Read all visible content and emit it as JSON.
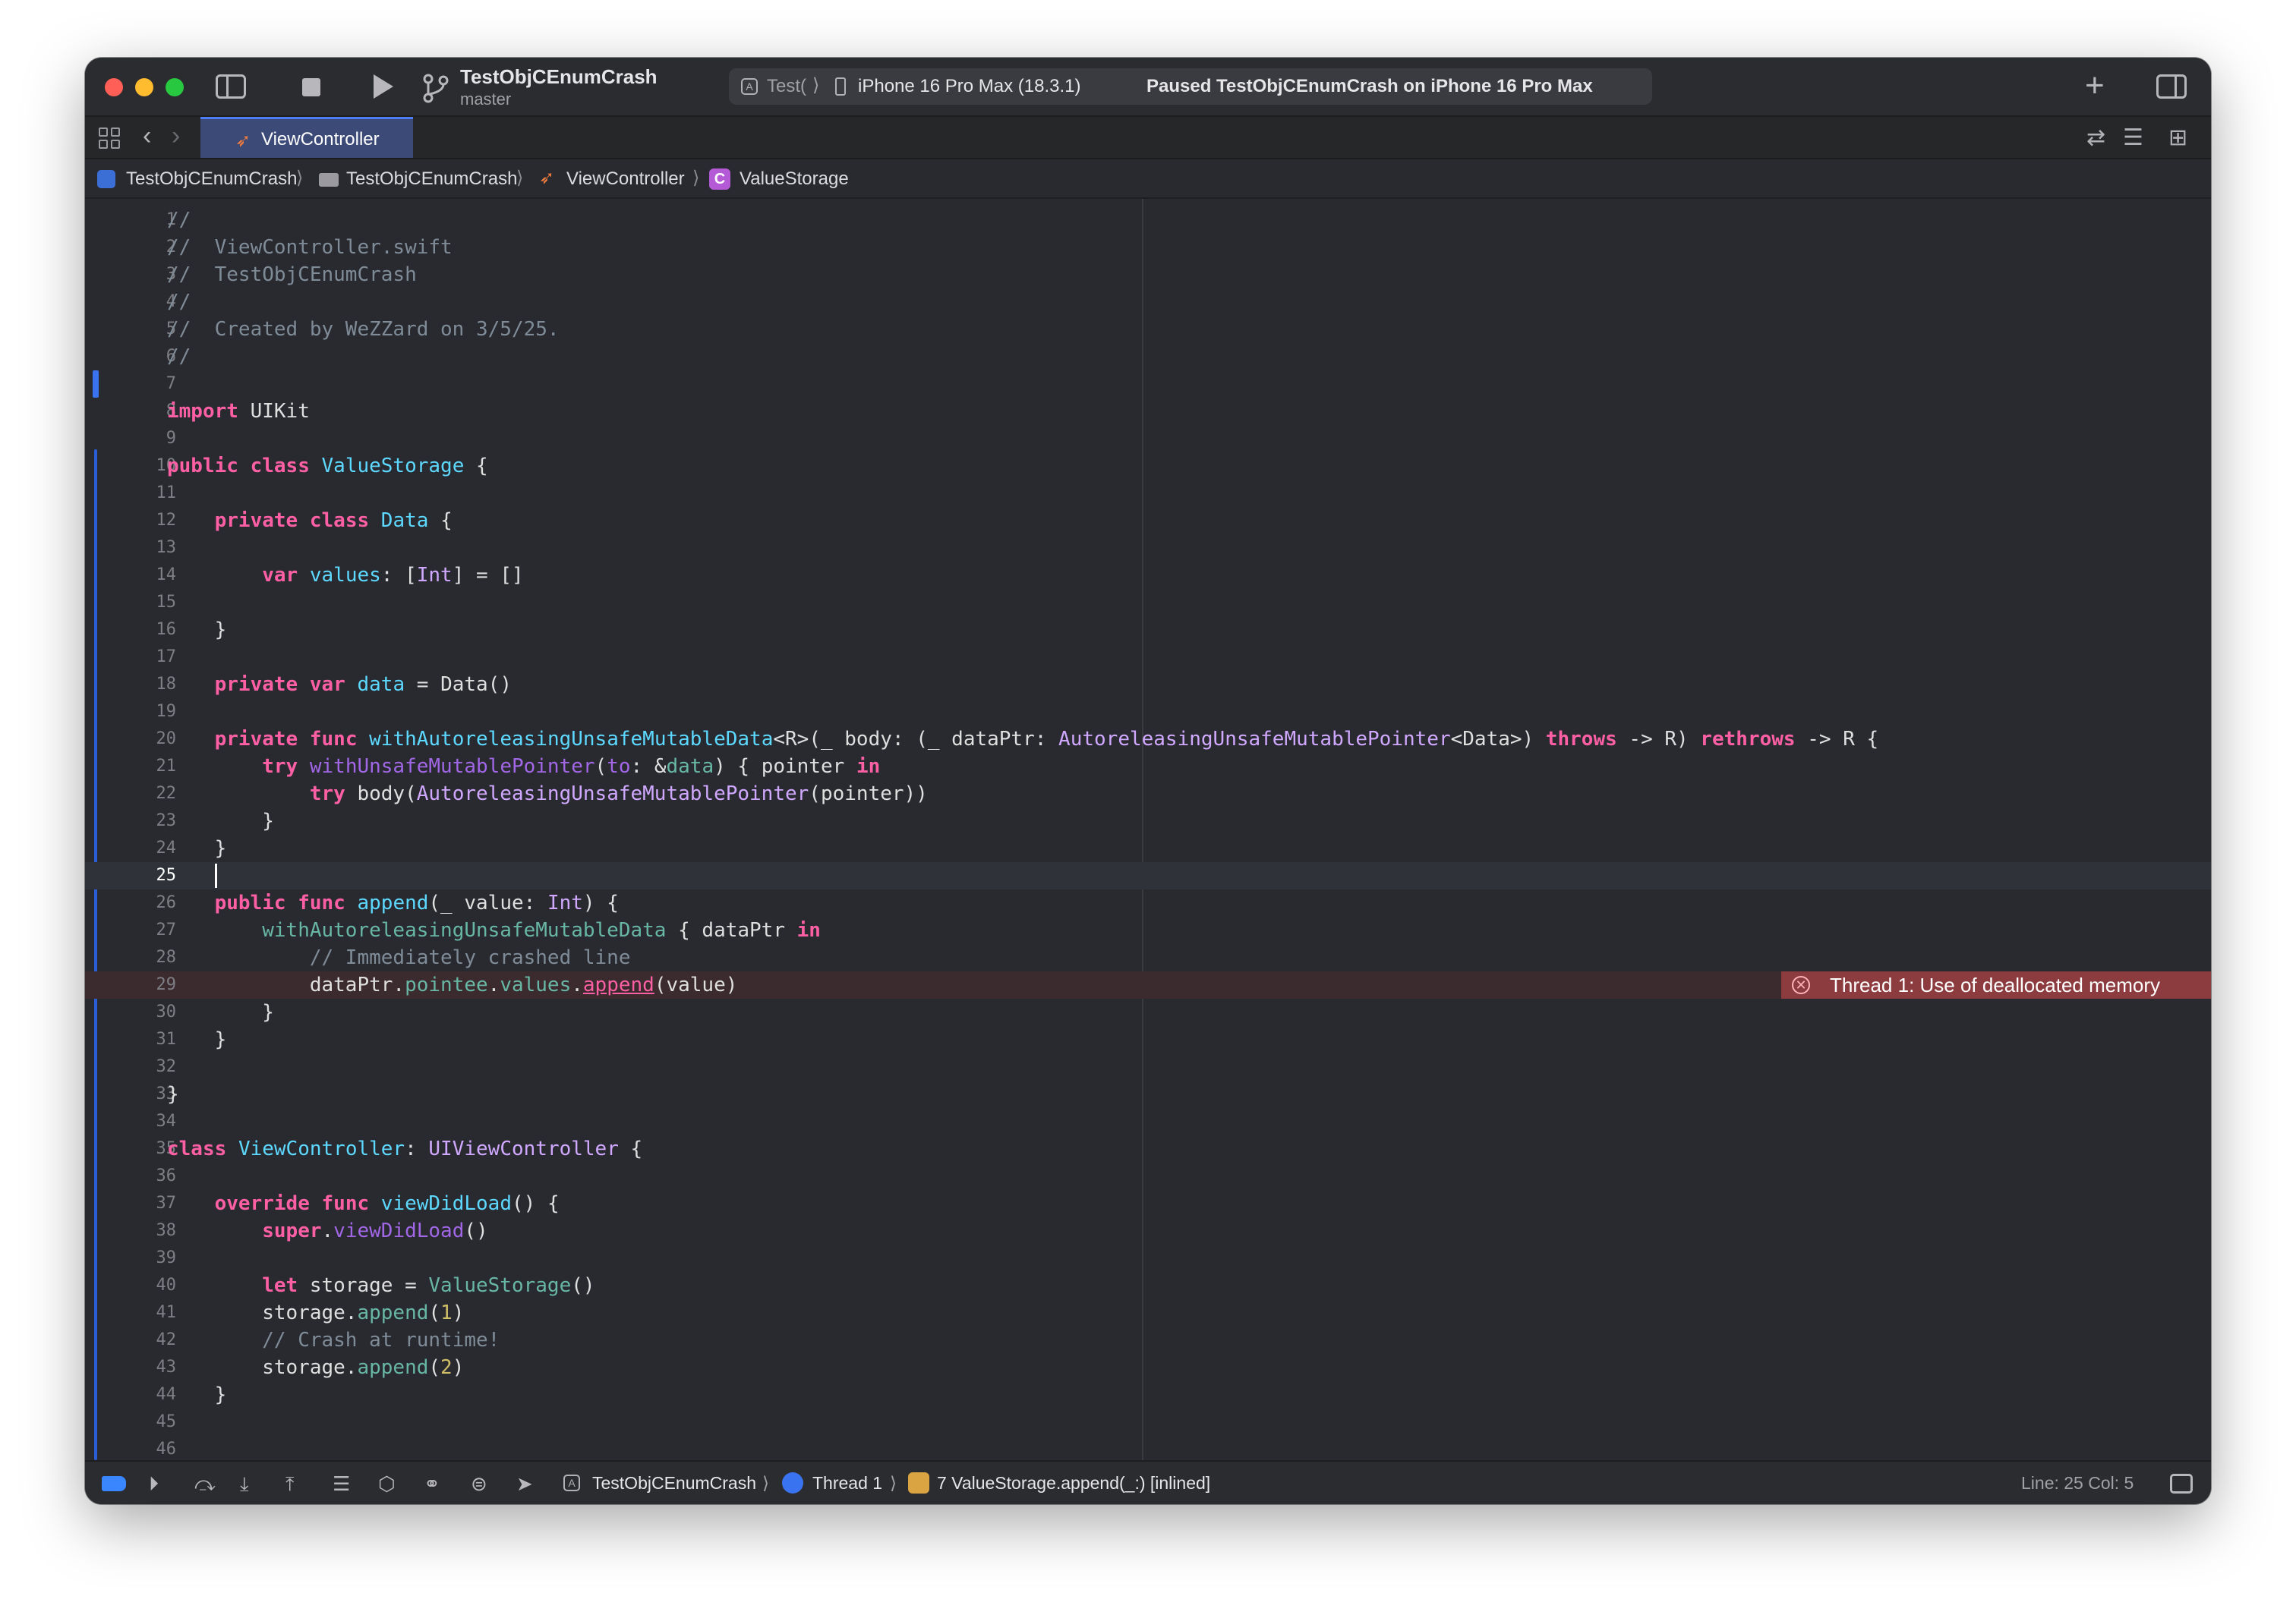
{
  "window": {
    "scheme_name": "TestObjCEnumCrash",
    "branch": "master",
    "destination_scheme": "Test(",
    "destination_device": "iPhone 16 Pro Max (18.3.1)",
    "status": "Paused TestObjCEnumCrash on iPhone 16 Pro Max"
  },
  "tabs": [
    {
      "label": "ViewController",
      "active": true
    }
  ],
  "breadcrumb": {
    "project": "TestObjCEnumCrash",
    "folder": "TestObjCEnumCrash",
    "file": "ViewController",
    "symbol": "ValueStorage",
    "symbol_kind": "C"
  },
  "editor": {
    "current_line": 25,
    "error_line": 29,
    "error_message": "Thread 1: Use of deallocated memory",
    "lines": [
      [
        [
          "cm",
          "//"
        ]
      ],
      [
        [
          "cm",
          "//  ViewController.swift"
        ]
      ],
      [
        [
          "cm",
          "//  TestObjCEnumCrash"
        ]
      ],
      [
        [
          "cm",
          "//"
        ]
      ],
      [
        [
          "cm",
          "//  Created by WeZZard on 3/5/25."
        ]
      ],
      [
        [
          "cm",
          "//"
        ]
      ],
      [],
      [
        [
          "k",
          "import"
        ],
        [
          "pl",
          " UIKit"
        ]
      ],
      [],
      [
        [
          "k",
          "public"
        ],
        [
          "pl",
          " "
        ],
        [
          "k",
          "class"
        ],
        [
          "pl",
          " "
        ],
        [
          "t",
          "ValueStorage"
        ],
        [
          "pl",
          " {"
        ]
      ],
      [],
      [
        [
          "pl",
          "    "
        ],
        [
          "k",
          "private"
        ],
        [
          "pl",
          " "
        ],
        [
          "k",
          "class"
        ],
        [
          "pl",
          " "
        ],
        [
          "t",
          "Data"
        ],
        [
          "pl",
          " {"
        ]
      ],
      [],
      [
        [
          "pl",
          "        "
        ],
        [
          "k",
          "var"
        ],
        [
          "pl",
          " "
        ],
        [
          "t",
          "values"
        ],
        [
          "pl",
          ": ["
        ],
        [
          "tp",
          "Int"
        ],
        [
          "pl",
          "] = []"
        ]
      ],
      [],
      [
        [
          "pl",
          "    }"
        ]
      ],
      [],
      [
        [
          "pl",
          "    "
        ],
        [
          "k",
          "private"
        ],
        [
          "pl",
          " "
        ],
        [
          "k",
          "var"
        ],
        [
          "pl",
          " "
        ],
        [
          "t",
          "data"
        ],
        [
          "pl",
          " = Data()"
        ]
      ],
      [],
      [
        [
          "pl",
          "    "
        ],
        [
          "k",
          "private"
        ],
        [
          "pl",
          " "
        ],
        [
          "k",
          "func"
        ],
        [
          "pl",
          " "
        ],
        [
          "t",
          "withAutoreleasingUnsafeMutableData"
        ],
        [
          "pl",
          "<R>(_ body: (_ dataPtr: "
        ],
        [
          "tp",
          "AutoreleasingUnsafeMutablePointer"
        ],
        [
          "pl",
          "<Data>) "
        ],
        [
          "k",
          "throws"
        ],
        [
          "pl",
          " -> R) "
        ],
        [
          "k",
          "rethrows"
        ],
        [
          "pl",
          " -> R {"
        ]
      ],
      [
        [
          "pl",
          "        "
        ],
        [
          "k",
          "try"
        ],
        [
          "pl",
          " "
        ],
        [
          "mu",
          "withUnsafeMutablePointer"
        ],
        [
          "pl",
          "("
        ],
        [
          "mu",
          "to"
        ],
        [
          "pl",
          ": &"
        ],
        [
          "fn",
          "data"
        ],
        [
          "pl",
          ") { pointer "
        ],
        [
          "k",
          "in"
        ]
      ],
      [
        [
          "pl",
          "            "
        ],
        [
          "k",
          "try"
        ],
        [
          "pl",
          " body("
        ],
        [
          "tp",
          "AutoreleasingUnsafeMutablePointer"
        ],
        [
          "pl",
          "(pointer))"
        ]
      ],
      [
        [
          "pl",
          "        }"
        ]
      ],
      [
        [
          "pl",
          "    }"
        ]
      ],
      [
        [
          "pl",
          "    "
        ]
      ],
      [
        [
          "pl",
          "    "
        ],
        [
          "k",
          "public"
        ],
        [
          "pl",
          " "
        ],
        [
          "k",
          "func"
        ],
        [
          "pl",
          " "
        ],
        [
          "t",
          "append"
        ],
        [
          "pl",
          "(_ value: "
        ],
        [
          "tp",
          "Int"
        ],
        [
          "pl",
          ") {"
        ]
      ],
      [
        [
          "pl",
          "        "
        ],
        [
          "fn",
          "withAutoreleasingUnsafeMutableData"
        ],
        [
          "pl",
          " { dataPtr "
        ],
        [
          "k",
          "in"
        ]
      ],
      [
        [
          "pl",
          "            "
        ],
        [
          "cm",
          "// Immediately crashed line"
        ]
      ],
      [
        [
          "pl",
          "            dataPtr."
        ],
        [
          "fn",
          "pointee"
        ],
        [
          "pl",
          "."
        ],
        [
          "fn",
          "values"
        ],
        [
          "pl",
          "."
        ],
        [
          "err",
          "append"
        ],
        [
          "pl",
          "(value)"
        ]
      ],
      [
        [
          "pl",
          "        }"
        ]
      ],
      [
        [
          "pl",
          "    }"
        ]
      ],
      [],
      [
        [
          "pl",
          "}"
        ]
      ],
      [],
      [
        [
          "k",
          "class"
        ],
        [
          "pl",
          " "
        ],
        [
          "t",
          "ViewController"
        ],
        [
          "pl",
          ": "
        ],
        [
          "tp",
          "UIViewController"
        ],
        [
          "pl",
          " {"
        ]
      ],
      [],
      [
        [
          "pl",
          "    "
        ],
        [
          "k",
          "override"
        ],
        [
          "pl",
          " "
        ],
        [
          "k",
          "func"
        ],
        [
          "pl",
          " "
        ],
        [
          "t",
          "viewDidLoad"
        ],
        [
          "pl",
          "() {"
        ]
      ],
      [
        [
          "pl",
          "        "
        ],
        [
          "k",
          "super"
        ],
        [
          "pl",
          "."
        ],
        [
          "mu",
          "viewDidLoad"
        ],
        [
          "pl",
          "()"
        ]
      ],
      [],
      [
        [
          "pl",
          "        "
        ],
        [
          "k",
          "let"
        ],
        [
          "pl",
          " storage = "
        ],
        [
          "fn",
          "ValueStorage"
        ],
        [
          "pl",
          "()"
        ]
      ],
      [
        [
          "pl",
          "        storage."
        ],
        [
          "fn",
          "append"
        ],
        [
          "pl",
          "("
        ],
        [
          "nm",
          "1"
        ],
        [
          "pl",
          ")"
        ]
      ],
      [
        [
          "pl",
          "        "
        ],
        [
          "cm",
          "// Crash at runtime!"
        ]
      ],
      [
        [
          "pl",
          "        storage."
        ],
        [
          "fn",
          "append"
        ],
        [
          "pl",
          "("
        ],
        [
          "nm",
          "2"
        ],
        [
          "pl",
          ")"
        ]
      ],
      [
        [
          "pl",
          "    }"
        ]
      ],
      [],
      []
    ]
  },
  "debug_bar": {
    "process": "TestObjCEnumCrash",
    "thread": "Thread 1",
    "frame": "7 ValueStorage.append(_:) [inlined]",
    "position": "Line: 25  Col: 5"
  },
  "colors": {
    "editor_bg": "#292a30",
    "keyword": "#fc5fa3",
    "type_decl": "#5dd8ff",
    "comment": "#7f8c98",
    "error_banner": "#8c3b3f",
    "accent": "#3a73f0"
  }
}
